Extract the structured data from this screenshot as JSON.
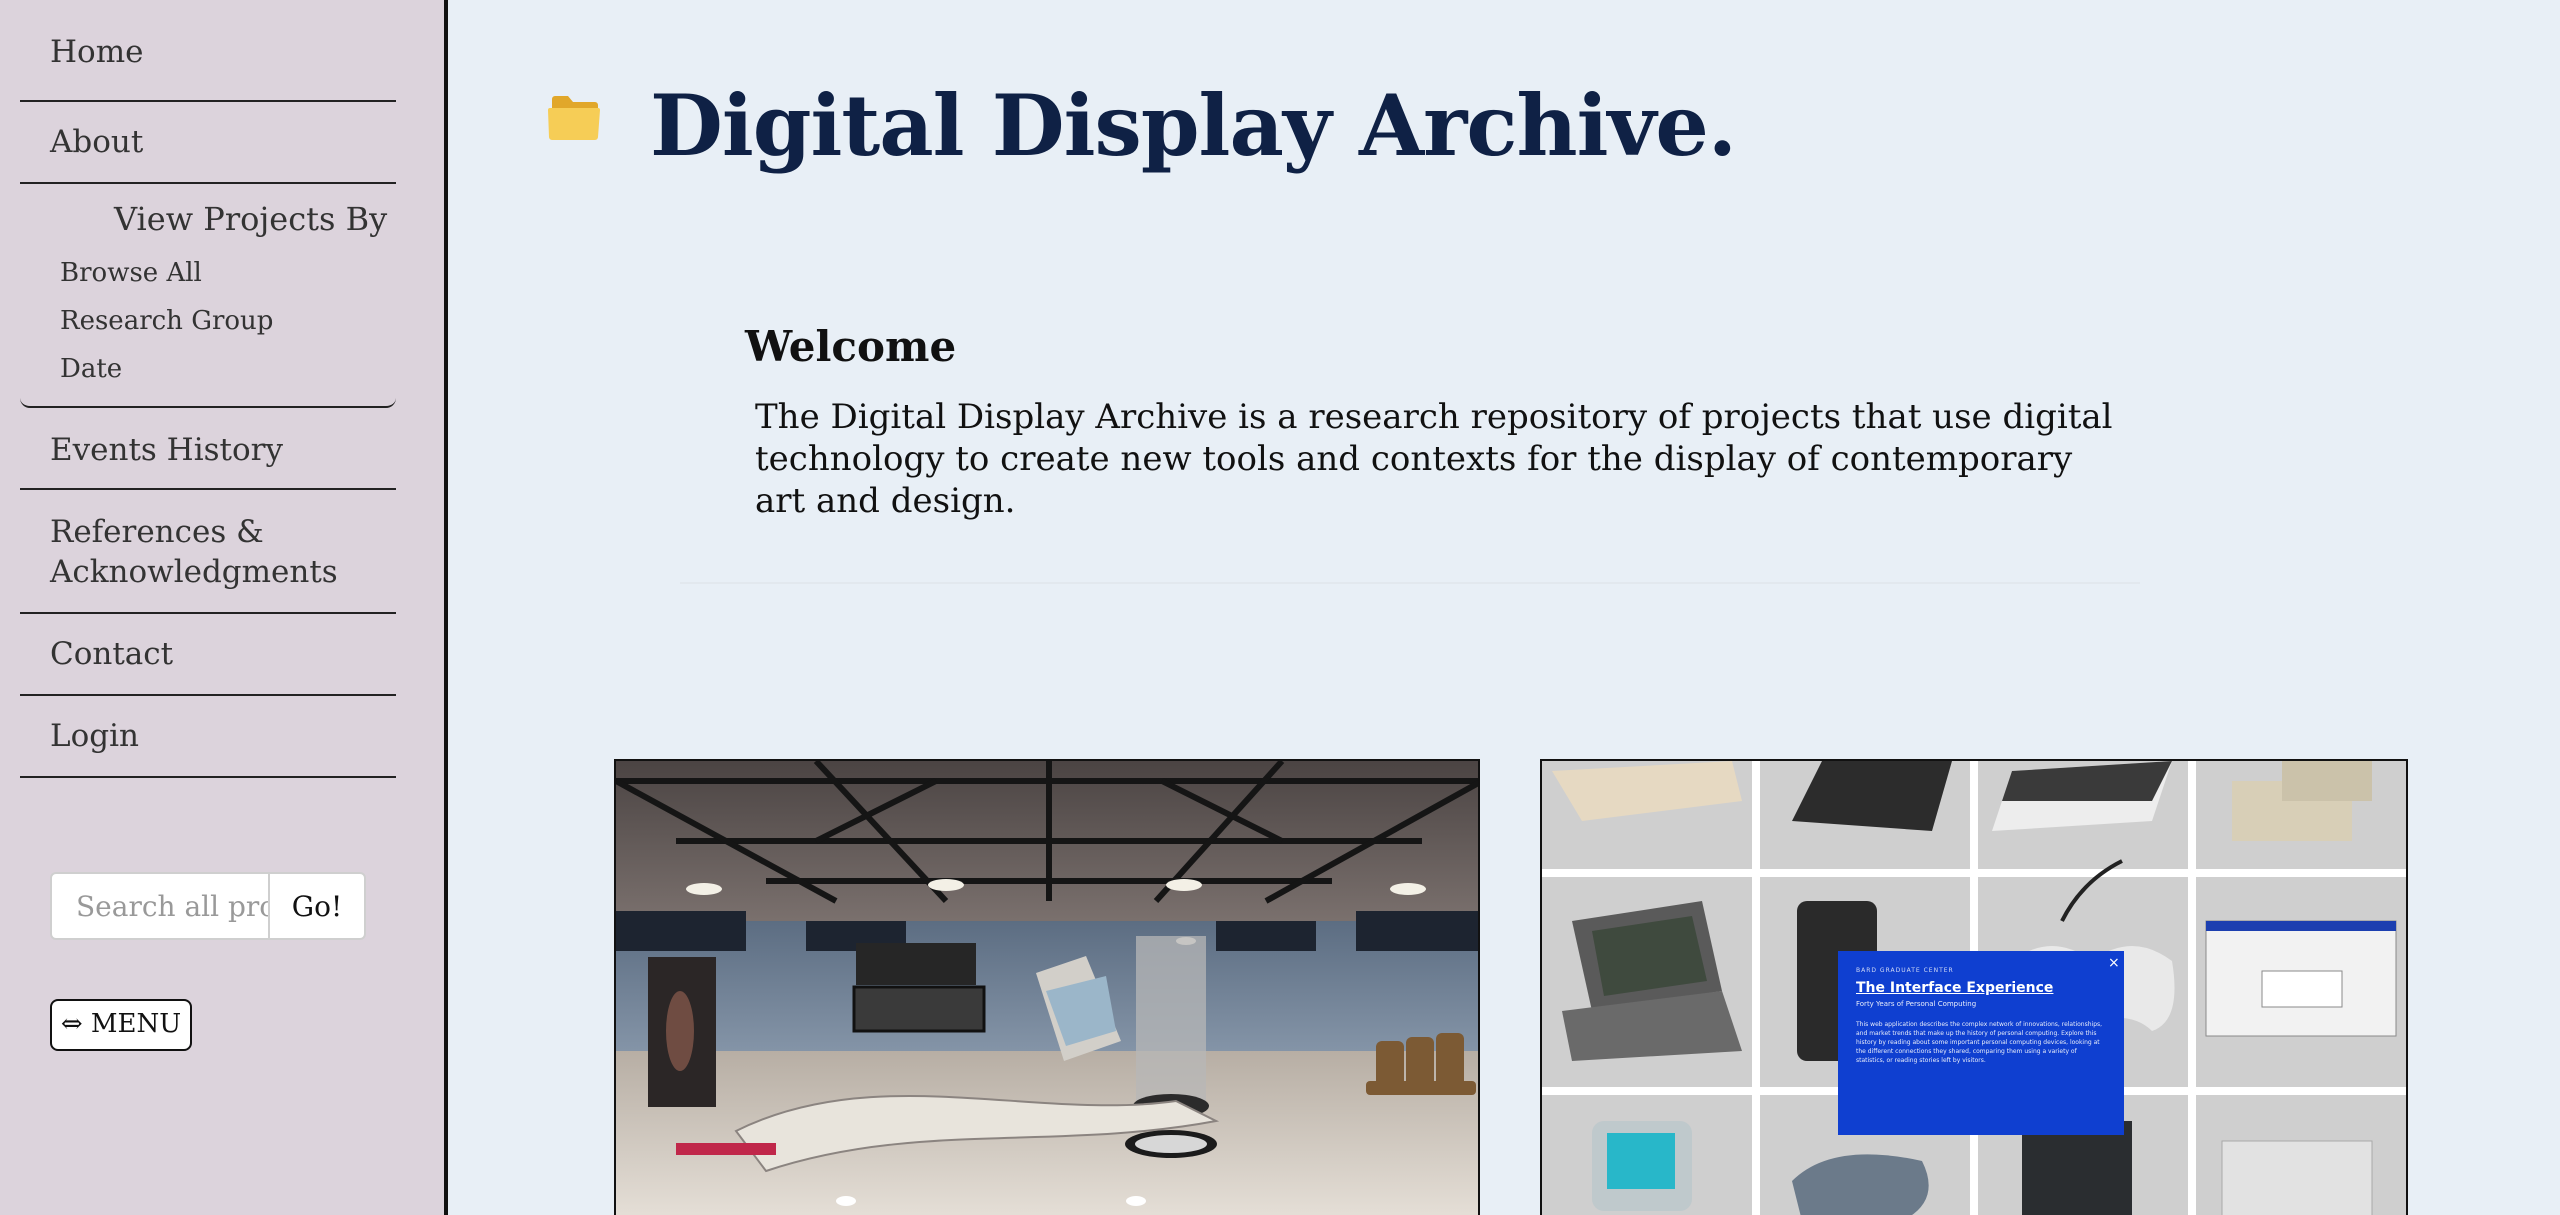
{
  "sidebar": {
    "nav": [
      {
        "label": "Home"
      },
      {
        "label": "About"
      },
      {
        "label": "Events History"
      },
      {
        "label": "References & Acknowledgments"
      },
      {
        "label": "Contact"
      },
      {
        "label": "Login"
      }
    ],
    "projects": {
      "title": "View Projects By",
      "items": [
        "Browse All",
        "Research Group",
        "Date"
      ]
    },
    "search": {
      "placeholder": "Search all projects",
      "button": "Go!"
    },
    "menu_button": "⇔ MENU"
  },
  "header": {
    "title": "Digital Display Archive.",
    "icon": "folder-icon"
  },
  "welcome": {
    "title": "Welcome",
    "text": "The Digital Display Archive is a research repository of projects that use digital technology to create new tools and contexts for the display of contemporary art and design."
  },
  "cards": {
    "right_popup": {
      "kicker": "BARD GRADUATE CENTER",
      "title": "The Interface Experience",
      "subtitle": "Forty Years of Personal Computing",
      "body": "This web application describes the complex network of innovations, relationships, and market trends that make up the history of personal computing. Explore this history by reading about some important personal computing devices, looking at the different connections they shared, comparing them using a variety of statistics, or reading stories left by visitors."
    }
  },
  "colors": {
    "sidebar_bg": "#dcd3dc",
    "main_bg": "#e8eff6",
    "title": "#0f2145",
    "popup_blue": "#0f3fd0"
  }
}
